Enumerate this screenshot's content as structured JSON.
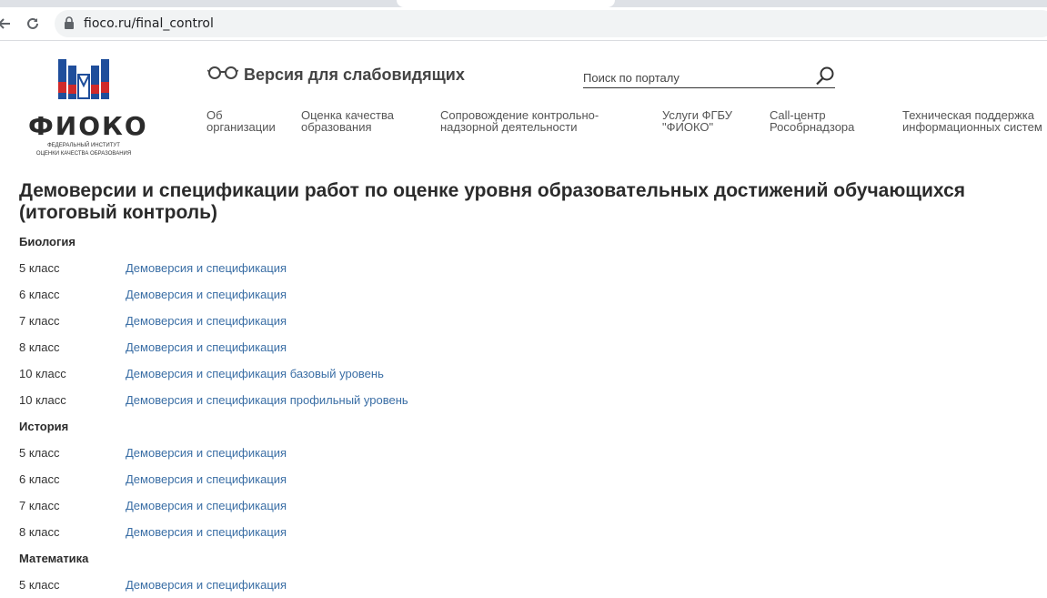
{
  "browser": {
    "url": "fioco.ru/final_control"
  },
  "header": {
    "logo": {
      "name": "ФИОКО",
      "subtitle_line1": "Федеральный институт",
      "subtitle_line2": "оценки качества образования"
    },
    "vision_label": "Версия для слабовидящих",
    "search_placeholder": "Поиск по порталу",
    "menu": [
      {
        "line1": "Об",
        "line2": "организации"
      },
      {
        "line1": "Оценка качества",
        "line2": "образования"
      },
      {
        "line1": "Сопровождение контрольно-",
        "line2": "надзорной деятельности"
      },
      {
        "line1": "Услуги ФГБУ",
        "line2": "\"ФИОКО\""
      },
      {
        "line1": "Call-центр",
        "line2": "Рособрнадзора"
      },
      {
        "line1": "Техническая поддержка",
        "line2": "информационных систем"
      }
    ]
  },
  "page": {
    "title": "Демоверсии и спецификации работ по оценке уровня образовательных достижений обучающихся (итоговый контроль)"
  },
  "subjects": [
    {
      "name": "Биология",
      "rows": [
        {
          "grade": "5 класс",
          "link": "Демоверсия и спецификация"
        },
        {
          "grade": "6 класс",
          "link": "Демоверсия и спецификация"
        },
        {
          "grade": "7 класс",
          "link": "Демоверсия и спецификация"
        },
        {
          "grade": "8 класс",
          "link": "Демоверсия и спецификация"
        },
        {
          "grade": "10 класс",
          "link": "Демоверсия и спецификация базовый уровень"
        },
        {
          "grade": "10 класс",
          "link": "Демоверсия и спецификация профильный уровень"
        }
      ]
    },
    {
      "name": "История",
      "rows": [
        {
          "grade": "5 класс",
          "link": "Демоверсия и спецификация"
        },
        {
          "grade": "6 класс",
          "link": "Демоверсия и спецификация"
        },
        {
          "grade": "7 класс",
          "link": "Демоверсия и спецификация"
        },
        {
          "grade": "8 класс",
          "link": "Демоверсия и спецификация"
        }
      ]
    },
    {
      "name": "Математика",
      "rows": [
        {
          "grade": "5 класс",
          "link": "Демоверсия и спецификация"
        }
      ]
    }
  ],
  "colors": {
    "link": "#3a6ea5",
    "logo_blue": "#1f4e9b",
    "logo_red": "#d02a2a"
  }
}
